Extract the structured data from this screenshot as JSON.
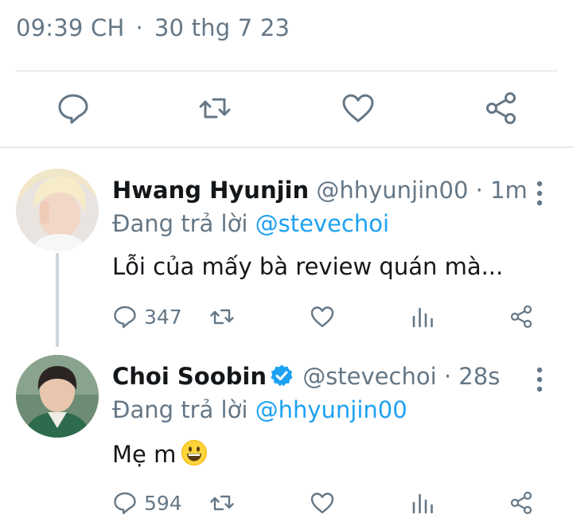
{
  "timestamp": {
    "time": "09:39 CH",
    "dot": "·",
    "date": "30 thg 7 23"
  },
  "main_actions": [
    "reply-icon",
    "retweet-icon",
    "like-icon",
    "share-icon"
  ],
  "colors": {
    "text": "#14171a",
    "muted": "#657786",
    "link": "#1da1f2",
    "divider": "#e6ecf0",
    "verified": "#1da1f2"
  },
  "replies": [
    {
      "name": "Hwang Hyunjin",
      "handle": "@hhyunjin00",
      "separator": "·",
      "time": "1m",
      "verified": false,
      "replying_prefix": "Đang trả lời",
      "replying_to": "@stevechoi",
      "text": "Lỗi của mấy bà review quán mà...",
      "reply_count": "347"
    },
    {
      "name": "Choi Soobin",
      "handle": "@stevechoi",
      "separator": "·",
      "time": "28s",
      "verified": true,
      "replying_prefix": "Đang trả lời",
      "replying_to": "@hhyunjin00",
      "text": "Mẹ m",
      "emoji": "grinning-face-emoji",
      "reply_count": "594"
    }
  ]
}
